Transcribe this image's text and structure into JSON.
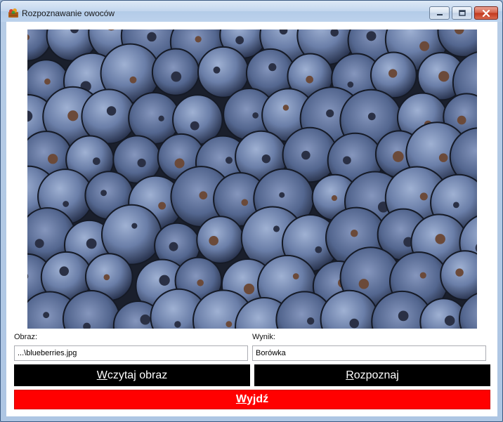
{
  "window": {
    "title": "Rozpoznawanie owoców",
    "icon": "fruit-basket-icon",
    "controls": [
      "minimize-icon",
      "maximize-icon",
      "close-icon"
    ]
  },
  "image": {
    "subject": "blueberries"
  },
  "form": {
    "image_label": "Obraz:",
    "image_value": "...\\blueberries.jpg",
    "result_label": "Wynik:",
    "result_value": "Borówka"
  },
  "buttons": {
    "load": {
      "mnemonic": "W",
      "rest": "czytaj obraz"
    },
    "recognize": {
      "mnemonic": "R",
      "rest": "ozpoznaj"
    },
    "exit": {
      "mnemonic": "W",
      "rest": "yjdź"
    }
  },
  "colors": {
    "button_bg": "#000000",
    "exit_bg": "#ff0000",
    "button_text": "#ffffff"
  }
}
